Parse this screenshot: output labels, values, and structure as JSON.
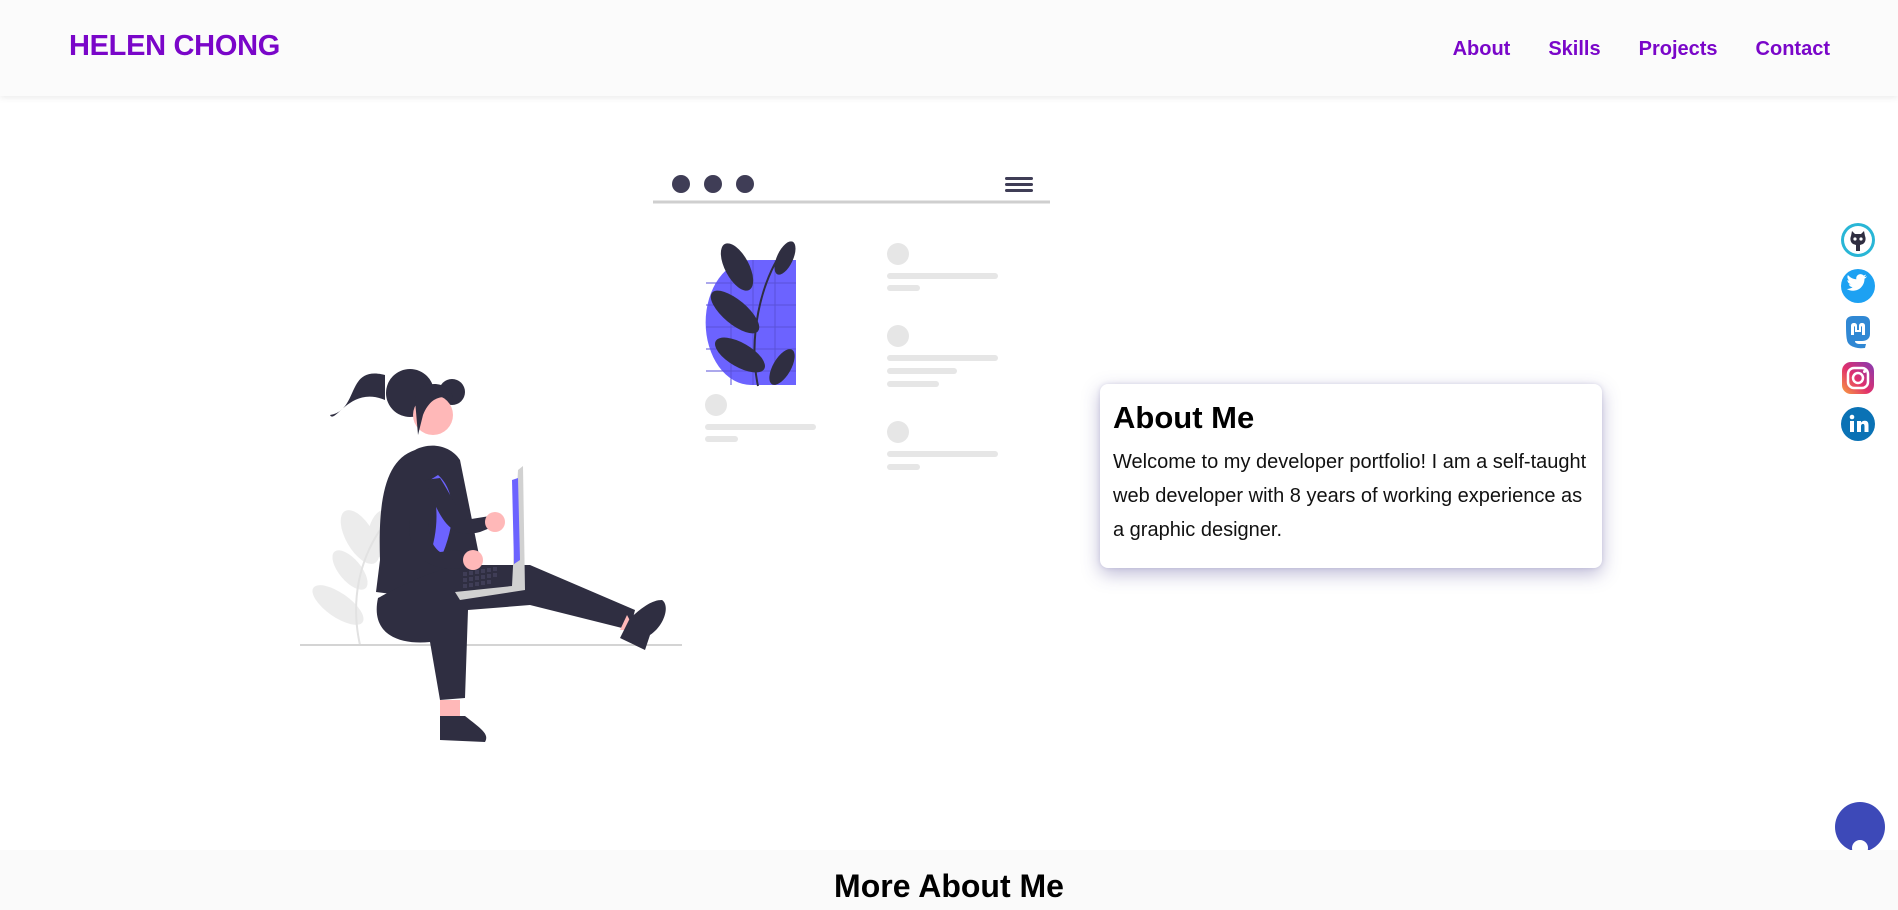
{
  "header": {
    "brand": "HELEN CHONG",
    "nav": [
      {
        "label": "About"
      },
      {
        "label": "Skills"
      },
      {
        "label": "Projects"
      },
      {
        "label": "Contact"
      }
    ]
  },
  "about": {
    "title": "About Me",
    "text": "Welcome to my developer portfolio! I am a self-taught web developer with 8 years of working experience as a graphic designer."
  },
  "social_icons": [
    "github-icon",
    "twitter-icon",
    "mastodon-icon",
    "instagram-icon",
    "linkedin-icon"
  ],
  "more_section": {
    "title": "More About Me"
  },
  "colors": {
    "brand": "#7a06c9",
    "illustration_accent": "#6c63ff",
    "illustration_dark": "#2f2e41",
    "fab": "#3d49b8"
  }
}
